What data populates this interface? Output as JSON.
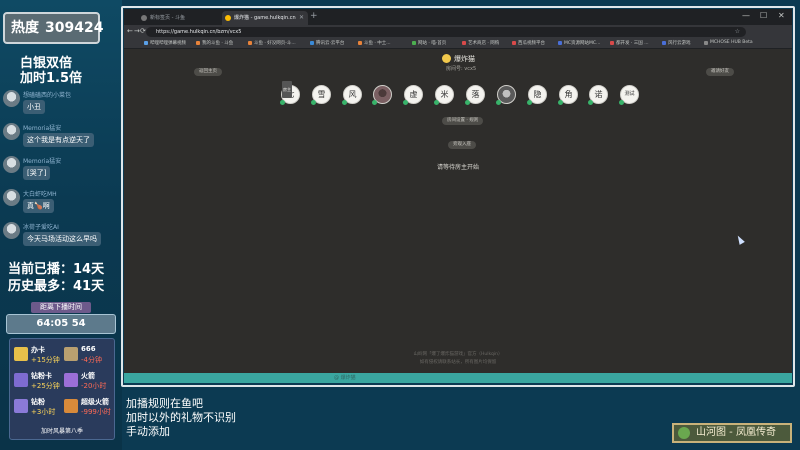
{
  "overlay": {
    "heat_label": "热度",
    "heat_value": "309424",
    "promo_line1": "白银双倍",
    "promo_line2": "加时1.5倍",
    "chat": [
      {
        "name": "想磕磕西的小菜包",
        "badge": "",
        "badge2": "",
        "message": "小丑"
      },
      {
        "name": "Memoria猛安",
        "badge": "",
        "badge2": "",
        "message": "这个我是有点逆天了"
      },
      {
        "name": "Memoria猛安",
        "badge": "",
        "badge2": "",
        "message": "[哭了]"
      },
      {
        "name": "大白虾吃MH",
        "badge": "",
        "badge2": "",
        "message": "真🍗啊"
      },
      {
        "name": "冰荷子爱吃AI",
        "badge": "",
        "badge2": "",
        "message": "今天马场活动这么早吗"
      }
    ],
    "stat_current": "当前已播：14天",
    "stat_best": "历史最多：41天",
    "timer_title": "距离下播时间",
    "timer_value": "64:05 54",
    "gifts": [
      {
        "name": "办卡",
        "value": "+15分钟",
        "kind": "plus",
        "color": "#e8c04a"
      },
      {
        "name": "666",
        "value": "-4分钟",
        "kind": "minus",
        "color": "#b9a070"
      },
      {
        "name": "钻粉卡",
        "value": "+25分钟",
        "kind": "plus",
        "color": "#7e6bd0"
      },
      {
        "name": "火箭",
        "value": "-20小时",
        "kind": "minus",
        "color": "#9c6fd8"
      },
      {
        "name": "钻粉",
        "value": "+3小时",
        "kind": "plus",
        "color": "#8b7ad8"
      },
      {
        "name": "超级火箭",
        "value": "-999小时",
        "kind": "minus",
        "color": "#d88a3a"
      }
    ],
    "gift_footer": "加时风暴第八季",
    "rules_line1": "加播规则在鱼吧",
    "rules_line2": "加时以外的礼物不识别",
    "rules_line3": "手动添加",
    "song": "山河图 - 凤凰传奇"
  },
  "browser": {
    "tabs": [
      {
        "title": "新标签页 - 斗鱼",
        "active": false
      },
      {
        "title": "爆炸猫 - game.hulkqin.cn",
        "active": true
      }
    ],
    "new_tab": "+",
    "window_controls": [
      "—",
      "☐",
      "✕"
    ],
    "nav": [
      "←",
      "→",
      "⟳"
    ],
    "url": "https://game.hulkqin.cn/bzm/vcx5",
    "bookmarks": [
      {
        "label": "哔哩哔哩弹幕视频",
        "color": "#5aa0e8"
      },
      {
        "label": "我的斗鱼 · 斗鱼",
        "color": "#e8833a"
      },
      {
        "label": "斗鱼 · 好没网页-斗...",
        "color": "#e8833a"
      },
      {
        "label": "腾讯云·云平台",
        "color": "#3a8ad8"
      },
      {
        "label": "斗鱼 · 中土...",
        "color": "#e8833a"
      },
      {
        "label": "网站 · 喵·首页",
        "color": "#4caf50"
      },
      {
        "label": "艺术商店 · 网购",
        "color": "#d84a4a"
      },
      {
        "label": "西瓜视频平台",
        "color": "#d84a4a"
      },
      {
        "label": "MC资源网站MC...",
        "color": "#4a6fd8"
      },
      {
        "label": "都开发 · 三国 ...",
        "color": "#d84a4a"
      },
      {
        "label": "风行云游戏",
        "color": "#4a6fd8"
      },
      {
        "label": "MCHOSE HUB Beta",
        "color": "#888888"
      }
    ],
    "page": {
      "back_label": "返回主页",
      "invite_label": "邀请好友",
      "room_title": "爆炸猫",
      "room_id_label": "房间号: vcx5",
      "seats": [
        {
          "label": "七",
          "tag": "房主",
          "style": ""
        },
        {
          "label": "雪",
          "tag": "",
          "style": ""
        },
        {
          "label": "风",
          "tag": "",
          "style": ""
        },
        {
          "label": "",
          "tag": "",
          "style": "photo"
        },
        {
          "label": "虚",
          "tag": "",
          "style": ""
        },
        {
          "label": "米",
          "tag": "",
          "style": ""
        },
        {
          "label": "落",
          "tag": "",
          "style": ""
        },
        {
          "label": "",
          "tag": "",
          "style": "photo2"
        },
        {
          "label": "隐",
          "tag": "",
          "style": ""
        },
        {
          "label": "角",
          "tag": "",
          "style": ""
        },
        {
          "label": "诺",
          "tag": "",
          "style": ""
        },
        {
          "label": "测试",
          "tag": "",
          "style": "small"
        }
      ],
      "settings_label": "房间设置 · 规则",
      "join_label": "旁观入座",
      "waiting_text": "请等待房主开始",
      "footer_line1": "山岭网「爆了爆炸猫游戏」官方（Hulkqin）",
      "footer_line2": "如有侵权请联系站长，所有图片均保留"
    },
    "status_text": "@ 爆炸猫"
  }
}
